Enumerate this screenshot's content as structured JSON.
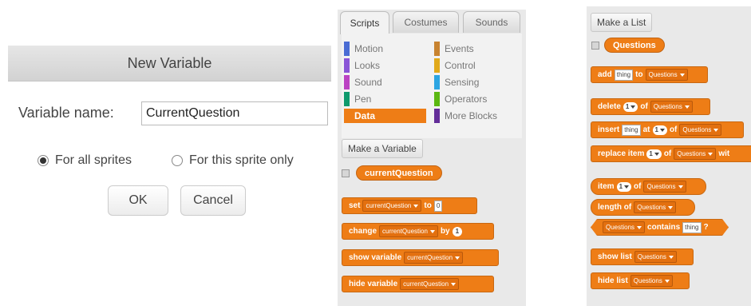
{
  "dialog": {
    "title": "New Variable",
    "label": "Variable name:",
    "value": "CurrentQuestion",
    "radio_all": "For all sprites",
    "radio_this": "For this sprite only",
    "ok": "OK",
    "cancel": "Cancel"
  },
  "palette": {
    "tabs": [
      "Scripts",
      "Costumes",
      "Sounds"
    ],
    "active_tab": "Scripts",
    "categories": [
      {
        "label": "Motion",
        "color": "#4a6cd4"
      },
      {
        "label": "Looks",
        "color": "#8a55d7"
      },
      {
        "label": "Sound",
        "color": "#bb42c3"
      },
      {
        "label": "Pen",
        "color": "#0e9a6c"
      },
      {
        "label": "Data",
        "color": "#ee7d16"
      },
      {
        "label": "Events",
        "color": "#c88330"
      },
      {
        "label": "Control",
        "color": "#e1a91a"
      },
      {
        "label": "Sensing",
        "color": "#2ca5e2"
      },
      {
        "label": "Operators",
        "color": "#5cb712"
      },
      {
        "label": "More Blocks",
        "color": "#632d99"
      }
    ],
    "selected_category": "Data",
    "make_variable": "Make a Variable",
    "variable_name": "currentQuestion",
    "set_block": {
      "w1": "set",
      "var": "currentQuestion",
      "w2": "to",
      "val": "0"
    },
    "change_block": {
      "w1": "change",
      "var": "currentQuestion",
      "w2": "by",
      "val": "1"
    },
    "show_block": {
      "w1": "show variable",
      "var": "currentQuestion"
    },
    "hide_block": {
      "w1": "hide variable",
      "var": "currentQuestion"
    }
  },
  "list_palette": {
    "make_list": "Make a List",
    "list_name": "Questions",
    "add_block": {
      "w1": "add",
      "field": "thing",
      "w2": "to",
      "list": "Questions"
    },
    "delete_block": {
      "w1": "delete",
      "num": "1",
      "w2": "of",
      "list": "Questions"
    },
    "insert_block": {
      "w1": "insert",
      "field": "thing",
      "w2": "at",
      "num": "1",
      "w3": "of",
      "list": "Questions"
    },
    "replace_block": {
      "w1": "replace item",
      "num": "1",
      "w2": "of",
      "list": "Questions",
      "w3": "wit"
    },
    "item_block": {
      "w1": "item",
      "num": "1",
      "w2": "of",
      "list": "Questions"
    },
    "length_block": {
      "w1": "length of",
      "list": "Questions"
    },
    "contains_block": {
      "list": "Questions",
      "w1": "contains",
      "field": "thing",
      "w2": "?"
    },
    "show_list_block": {
      "w1": "show list",
      "list": "Questions"
    },
    "hide_list_block": {
      "w1": "hide list",
      "list": "Questions"
    }
  },
  "colors": {
    "data_orange": "#ee7d16",
    "panel_bg": "#e9e9e9"
  }
}
